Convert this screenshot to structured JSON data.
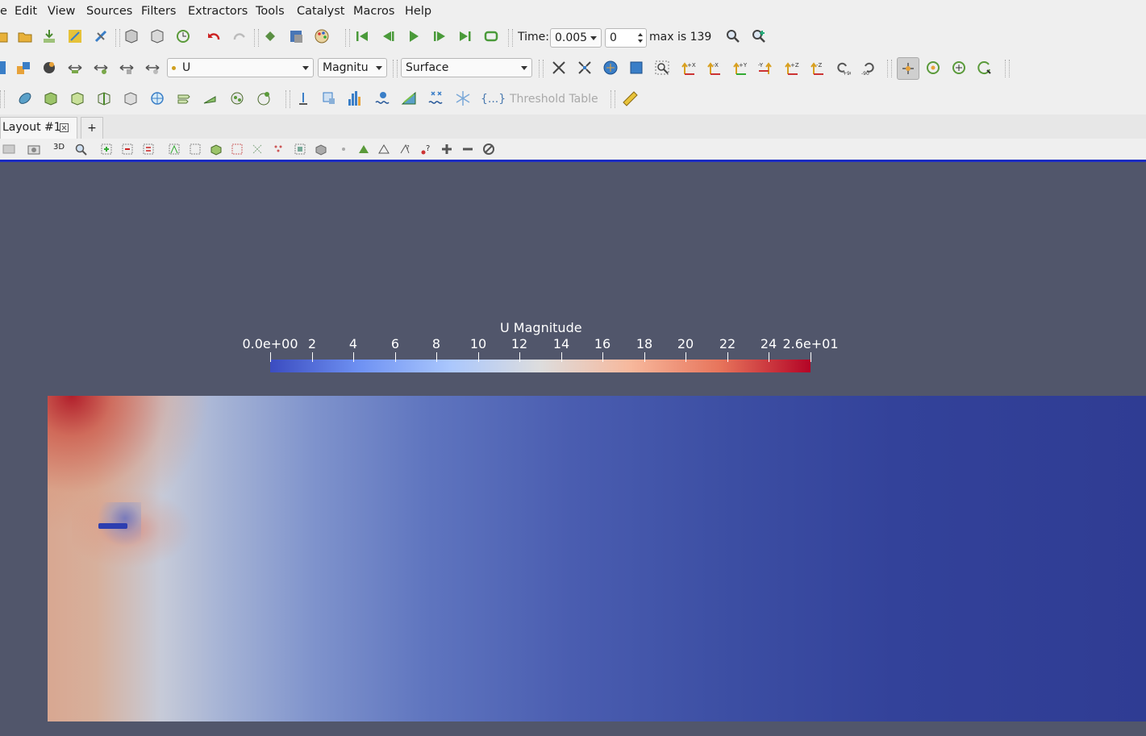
{
  "menubar": {
    "items": [
      "e",
      "Edit",
      "View",
      "Sources",
      "Filters",
      "Extractors",
      "Tools",
      "Catalyst",
      "Macros",
      "Help"
    ]
  },
  "time_toolbar": {
    "time_label": "Time:",
    "time_value": "0.005",
    "timestep_value": "0",
    "max_text": "max is 139"
  },
  "display_toolbar": {
    "color_array": "U",
    "component": "Magnitu",
    "representation": "Surface"
  },
  "filters_toolbar": {
    "threshold_table_label": "Threshold Table",
    "braces_label": "{...}"
  },
  "tabs": {
    "layout_label": "Layout #1",
    "add_label": "+"
  },
  "view_toolbar": {
    "mode_3d": "3D"
  },
  "chart_data": {
    "type": "heatmap",
    "title": "U Magnitude",
    "range": [
      0,
      26
    ],
    "tick_labels": [
      "0.0e+00",
      "2",
      "4",
      "6",
      "8",
      "10",
      "12",
      "14",
      "16",
      "18",
      "20",
      "22",
      "24",
      "2.6e+01"
    ],
    "tick_values": [
      0,
      2,
      4,
      6,
      8,
      10,
      12,
      14,
      16,
      18,
      20,
      22,
      24,
      26
    ],
    "colormap": [
      "#3b4cc0",
      "#6f92f3",
      "#aac7fd",
      "#dddddd",
      "#f7b89c",
      "#e7745b",
      "#b40426"
    ],
    "legend_placement": "top-center horizontal"
  },
  "colors": {
    "viewport_background": "#51566b",
    "active_view_border": "#1b2cc1"
  }
}
